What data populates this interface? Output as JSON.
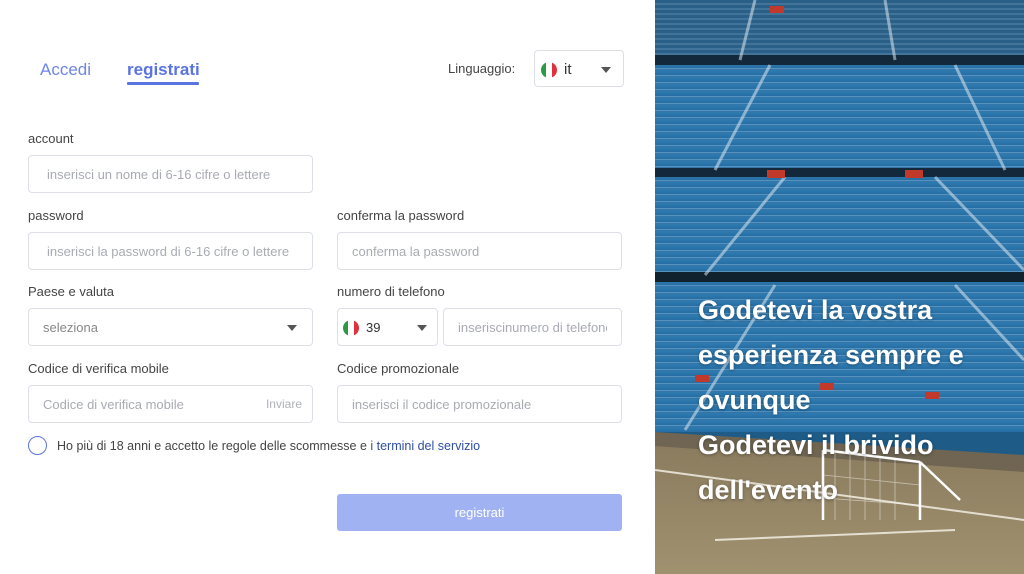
{
  "tabs": {
    "login": "Accedi",
    "register": "registrati"
  },
  "language": {
    "label": "Linguaggio:",
    "value": "it",
    "flag_icon": "italy-flag-icon"
  },
  "form": {
    "account": {
      "label": "account",
      "placeholder": "inserisci un nome di 6-16 cifre o lettere"
    },
    "password": {
      "label": "password",
      "placeholder": "inserisci la password di 6-16 cifre o lettere"
    },
    "confirm_password": {
      "label": "conferma la password",
      "placeholder": "conferma la password"
    },
    "country": {
      "label": "Paese e valuta",
      "value": "seleziona"
    },
    "phone": {
      "label": "numero di telefono",
      "prefix": "39",
      "placeholder": "inseriscinumero di telefono"
    },
    "verification": {
      "label": "Codice di verifica mobile",
      "placeholder": "Codice di verifica mobile",
      "send_label": "Inviare"
    },
    "promo": {
      "label": "Codice promozionale",
      "placeholder": "inserisci il codice promozionale"
    },
    "agreement": {
      "text": "Ho più di 18 anni e accetto le regole delle scommesse e ",
      "link": "i termini del servizio"
    },
    "submit_label": "registrati"
  },
  "hero": {
    "lines": [
      "Godetevi la vostra",
      "esperienza sempre e",
      "ovunque",
      "Godetevi il brivido",
      "dell'evento"
    ]
  },
  "colors": {
    "accent": "#5a74e0",
    "submit_disabled": "#a1b2f3",
    "link": "#2f4ea8",
    "stadium_seats": "#2a6fa0"
  }
}
